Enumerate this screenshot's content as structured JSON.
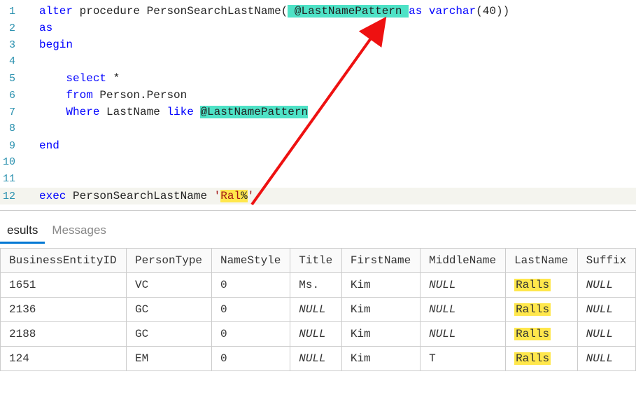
{
  "code": {
    "lines": [
      {
        "n": "1",
        "tokens": [
          {
            "t": "alter",
            "c": "kw"
          },
          {
            "t": " procedure ",
            "c": "plain"
          },
          {
            "t": "PersonSearchLastName",
            "c": "plain"
          },
          {
            "t": "(",
            "c": "plain"
          },
          {
            "t": " @LastNamePattern ",
            "c": "plain",
            "hl": "hl-teal"
          },
          {
            "t": "as",
            "c": "kw"
          },
          {
            "t": " ",
            "c": "plain"
          },
          {
            "t": "varchar",
            "c": "kw"
          },
          {
            "t": "(",
            "c": "plain"
          },
          {
            "t": "40",
            "c": "plain"
          },
          {
            "t": ")",
            "c": "plain"
          },
          {
            "t": ")",
            "c": "plain"
          }
        ]
      },
      {
        "n": "2",
        "tokens": [
          {
            "t": "as",
            "c": "kw"
          }
        ]
      },
      {
        "n": "3",
        "tokens": [
          {
            "t": "begin",
            "c": "kw"
          }
        ]
      },
      {
        "n": "4",
        "tokens": []
      },
      {
        "n": "5",
        "tokens": [
          {
            "t": "    ",
            "c": "plain"
          },
          {
            "t": "select",
            "c": "kw"
          },
          {
            "t": " *",
            "c": "plain"
          }
        ]
      },
      {
        "n": "6",
        "tokens": [
          {
            "t": "    ",
            "c": "plain"
          },
          {
            "t": "from",
            "c": "kw"
          },
          {
            "t": " Person",
            "c": "plain"
          },
          {
            "t": ".",
            "c": "plain"
          },
          {
            "t": "Person",
            "c": "plain"
          }
        ]
      },
      {
        "n": "7",
        "tokens": [
          {
            "t": "    ",
            "c": "plain"
          },
          {
            "t": "Where",
            "c": "kw"
          },
          {
            "t": " LastName ",
            "c": "plain"
          },
          {
            "t": "like",
            "c": "kw"
          },
          {
            "t": " ",
            "c": "plain"
          },
          {
            "t": "@LastNamePatt",
            "c": "plain",
            "hl": "hl-teal"
          },
          {
            "t": "ern",
            "c": "plain",
            "hl": "hl-teal"
          }
        ]
      },
      {
        "n": "8",
        "tokens": []
      },
      {
        "n": "9",
        "tokens": [
          {
            "t": "end",
            "c": "kw"
          }
        ]
      },
      {
        "n": "10",
        "tokens": []
      },
      {
        "n": "11",
        "tokens": []
      },
      {
        "n": "12",
        "current": true,
        "tokens": [
          {
            "t": "exec",
            "c": "kw"
          },
          {
            "t": " PersonSearchLastName ",
            "c": "plain"
          },
          {
            "t": "'",
            "c": "str"
          },
          {
            "t": "Ral",
            "c": "str",
            "hl": "hl-yellow"
          },
          {
            "t": "%",
            "c": "plain",
            "hl": "hl-yellow"
          },
          {
            "t": "'",
            "c": "str"
          }
        ]
      }
    ]
  },
  "tabs": {
    "results": "esults",
    "messages": "Messages"
  },
  "grid": {
    "headers": [
      "BusinessEntityID",
      "PersonType",
      "NameStyle",
      "Title",
      "FirstName",
      "MiddleName",
      "LastName",
      "Suffix"
    ],
    "hl_col": 6,
    "rows": [
      [
        "1651",
        "VC",
        "0",
        "Ms.",
        "Kim",
        "NULL",
        "Ralls",
        "NULL"
      ],
      [
        "2136",
        "GC",
        "0",
        "NULL",
        "Kim",
        "NULL",
        "Ralls",
        "NULL"
      ],
      [
        "2188",
        "GC",
        "0",
        "NULL",
        "Kim",
        "NULL",
        "Ralls",
        "NULL"
      ],
      [
        "124",
        "EM",
        "0",
        "NULL",
        "Kim",
        "T",
        "Ralls",
        "NULL"
      ]
    ]
  }
}
